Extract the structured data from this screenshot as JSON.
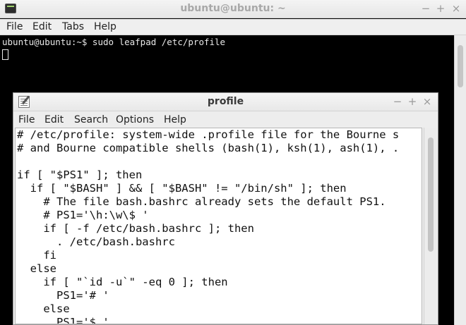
{
  "terminal": {
    "title": "ubuntu@ubuntu: ~",
    "controls": {
      "minimize": "−",
      "maximize": "+",
      "close": "×"
    },
    "menu": [
      "File",
      "Edit",
      "Tabs",
      "Help"
    ],
    "prompt_line": "ubuntu@ubuntu:~$ sudo leafpad /etc/profile"
  },
  "editor": {
    "title": "profile",
    "controls": {
      "minimize": "−",
      "maximize": "+",
      "close": "×"
    },
    "menu": [
      "File",
      "Edit",
      "Search",
      "Options",
      "Help"
    ],
    "lines": [
      "# /etc/profile: system-wide .profile file for the Bourne s",
      "# and Bourne compatible shells (bash(1), ksh(1), ash(1), .",
      "",
      "if [ \"$PS1\" ]; then",
      "  if [ \"$BASH\" ] && [ \"$BASH\" != \"/bin/sh\" ]; then",
      "    # The file bash.bashrc already sets the default PS1.",
      "    # PS1='\\h:\\w\\$ '",
      "    if [ -f /etc/bash.bashrc ]; then",
      "      . /etc/bash.bashrc",
      "    fi",
      "  else",
      "    if [ \"`id -u`\" -eq 0 ]; then",
      "      PS1='# '",
      "    else",
      "      PS1='$ '"
    ]
  }
}
